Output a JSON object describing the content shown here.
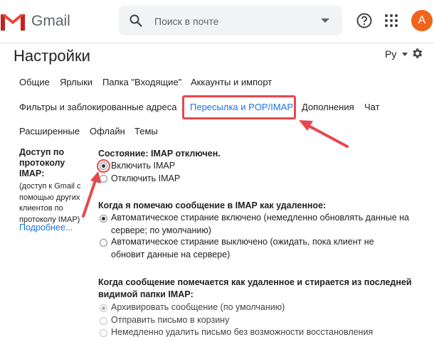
{
  "header": {
    "logo_text": "Gmail",
    "search_placeholder": "Поиск в почте",
    "avatar_letter": "A"
  },
  "page": {
    "title": "Настройки",
    "lang": "Ру"
  },
  "tabs": {
    "row1": [
      "Общие",
      "Ярлыки",
      "Папка \"Входящие\"",
      "Аккаунты и импорт"
    ],
    "row2": [
      "Фильтры и заблокированные адреса",
      "Пересылка и POP/IMAP",
      "Дополнения",
      "Чат"
    ],
    "row3": [
      "Расширенные",
      "Офлайн",
      "Темы"
    ],
    "active": "Пересылка и POP/IMAP"
  },
  "imap": {
    "left_title": "Доступ по протоколу IMAP:",
    "left_note": "(доступ к Gmail с помощью других клиентов по протоколу IMAP)",
    "more_link": "Подробнее...",
    "status": "Состояние: IMAP отключен.",
    "enable": "Включить IMAP",
    "disable": "Отключить IMAP",
    "q1": "Когда я помечаю сообщение в IMAP как удаленное:",
    "q1_opt1_line1": "Автоматическое стирание включено (немедленно обновлять данные на",
    "q1_opt1_line2": "сервере; по умолчанию)",
    "q1_opt2_line1": "Автоматическое стирание выключено (ожидать, пока клиент не",
    "q1_opt2_line2": "обновит данные на сервере)",
    "q2_line1": "Когда сообщение помечается как удаленное и стирается из последней",
    "q2_line2": "видимой папки IMAP:",
    "q2_opt1": "Архивировать сообщение (по умолчанию)",
    "q2_opt2": "Отправить письмо в корзину",
    "q2_opt3": "Немедленно удалить письмо без возможности восстановления"
  },
  "colors": {
    "accent": "#1a73e8",
    "annotation": "#e8474e",
    "avatar": "#f0641c"
  }
}
